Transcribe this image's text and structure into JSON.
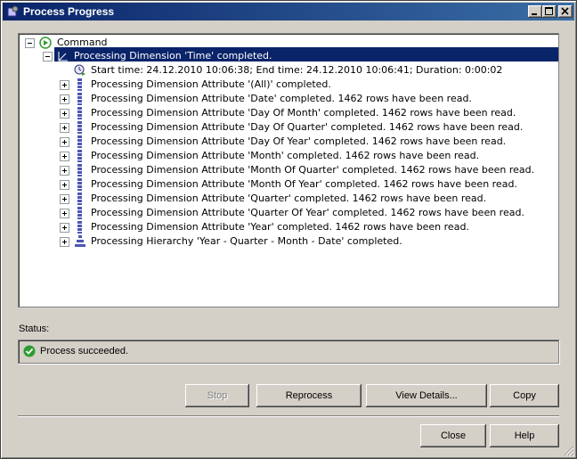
{
  "window": {
    "title": "Process Progress",
    "icon": "cube-gear-icon"
  },
  "tree": {
    "root": {
      "label": "Command",
      "icon": "play-circle-icon",
      "expanded": true
    },
    "dimension": {
      "label": "Processing Dimension 'Time' completed.",
      "icon": "dimension-axis-icon",
      "expanded": true,
      "selected": true
    },
    "timing": {
      "label": "Start time: 24.12.2010 10:06:38; End time: 24.12.2010 10:06:41; Duration: 0:00:02",
      "icon": "clock-icon"
    },
    "attributes": [
      "Processing Dimension Attribute '(All)' completed.",
      "Processing Dimension Attribute 'Date' completed. 1462 rows have been read.",
      "Processing Dimension Attribute 'Day Of Month' completed. 1462 rows have been read.",
      "Processing Dimension Attribute 'Day Of Quarter' completed. 1462 rows have been read.",
      "Processing Dimension Attribute 'Day Of Year' completed. 1462 rows have been read.",
      "Processing Dimension Attribute 'Month' completed. 1462 rows have been read.",
      "Processing Dimension Attribute 'Month Of Quarter' completed. 1462 rows have been read.",
      "Processing Dimension Attribute 'Month Of Year' completed. 1462 rows have been read.",
      "Processing Dimension Attribute 'Quarter' completed. 1462 rows have been read.",
      "Processing Dimension Attribute 'Quarter Of Year' completed. 1462 rows have been read.",
      "Processing Dimension Attribute 'Year' completed. 1462 rows have been read."
    ],
    "hierarchy": "Processing Hierarchy 'Year -  Quarter -  Month -  Date' completed."
  },
  "status": {
    "label": "Status:",
    "text": "Process succeeded.",
    "icon": "check-circle-icon"
  },
  "buttons": {
    "stop": "Stop",
    "reprocess": "Reprocess",
    "view_details": "View Details...",
    "copy": "Copy",
    "close": "Close",
    "help": "Help"
  },
  "colors": {
    "title_start": "#0a246a",
    "title_end": "#3a6ea5",
    "selection": "#0a246a",
    "success": "#2e9b2e",
    "attribute_icon": "#4a56b8"
  }
}
